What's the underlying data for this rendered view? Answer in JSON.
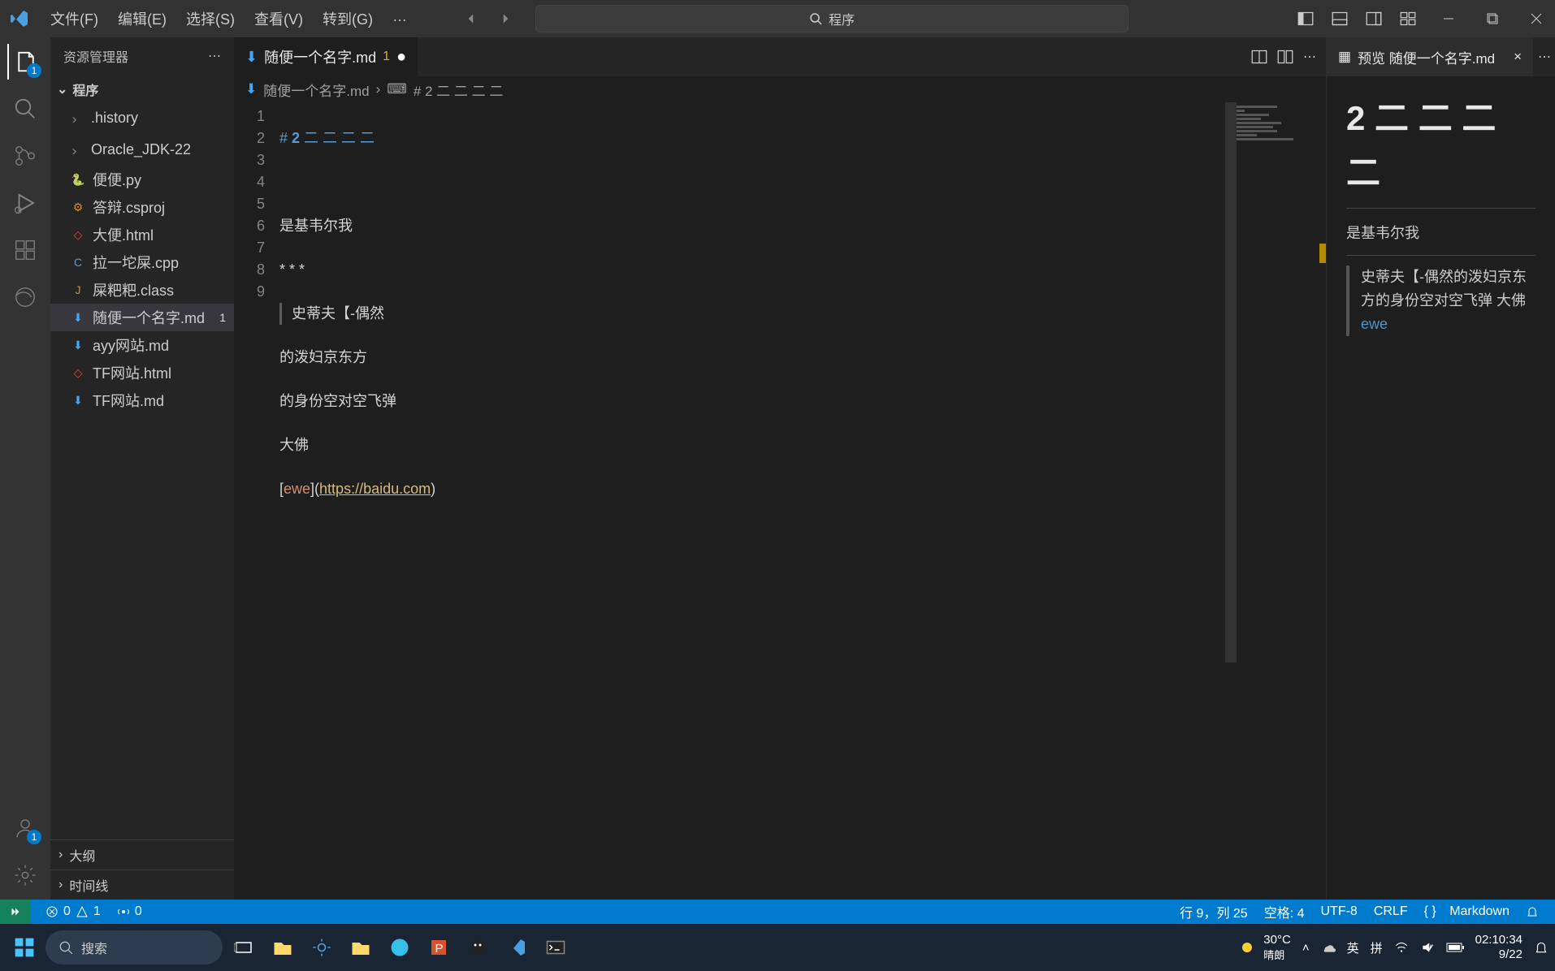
{
  "menu": {
    "file": "文件(F)",
    "edit": "编辑(E)",
    "select": "选择(S)",
    "view": "查看(V)",
    "goto": "转到(G)",
    "more": "…"
  },
  "search_placeholder": "程序",
  "sidebar": {
    "title": "资源管理器",
    "section": "程序",
    "files": [
      {
        "icon": ">",
        "name": ".history",
        "kind": "folder"
      },
      {
        "icon": ">",
        "name": "Oracle_JDK-22",
        "kind": "folder"
      },
      {
        "icon": "py",
        "name": "便便.py",
        "kind": "py"
      },
      {
        "icon": "cs",
        "name": "答辩.csproj",
        "kind": "cs"
      },
      {
        "icon": "<>",
        "name": "大便.html",
        "kind": "html"
      },
      {
        "icon": "C",
        "name": "拉一坨屎.cpp",
        "kind": "cpp"
      },
      {
        "icon": "J",
        "name": "屎粑粑.class",
        "kind": "java"
      },
      {
        "icon": "md",
        "name": "随便一个名字.md",
        "kind": "md",
        "selected": true,
        "mod": "1"
      },
      {
        "icon": "md",
        "name": "ayy网站.md",
        "kind": "md"
      },
      {
        "icon": "<>",
        "name": "TF网站.html",
        "kind": "html"
      },
      {
        "icon": "md",
        "name": "TF网站.md",
        "kind": "md"
      }
    ],
    "outline": "大纲",
    "timeline": "时间线"
  },
  "tab": {
    "name": "随便一个名字.md",
    "warn": "1"
  },
  "breadcrumb": {
    "file": "随便一个名字.md",
    "symbol": "# 2 二 二 二 二"
  },
  "code": {
    "l1_h": "# ",
    "l1_n": "2",
    "l1_rest": " 二 二 二 二",
    "l3": "是基韦尔我",
    "l4": "* * *",
    "l5": "史蒂夫【-偶然",
    "l6": "的泼妇京东方",
    "l7": "的身份空对空飞弹",
    "l8": "大佛",
    "l9_open": "[",
    "l9_text": "ewe",
    "l9_mid": "](",
    "l9_url": "https://baidu.com",
    "l9_close": ")"
  },
  "preview": {
    "tab": "预览 随便一个名字.md",
    "h1": "2 二 二 二 二",
    "p1": "是基韦尔我",
    "bq": "史蒂夫【-偶然的泼妇京东方的身份空对空飞弹 大佛 ",
    "link": "ewe"
  },
  "status": {
    "errors": "0",
    "warnings": "1",
    "ports": "0",
    "line_col": "行 9，列 25",
    "spaces": "空格: 4",
    "encoding": "UTF-8",
    "eol": "CRLF",
    "lang": "Markdown"
  },
  "taskbar": {
    "search": "搜索",
    "weather_temp": "30°C",
    "weather_desc": "晴朗",
    "ime1": "英",
    "ime2": "拼",
    "time": "02:10:34",
    "date": "9/22"
  },
  "badges": {
    "explorer": "1",
    "account": "1"
  }
}
